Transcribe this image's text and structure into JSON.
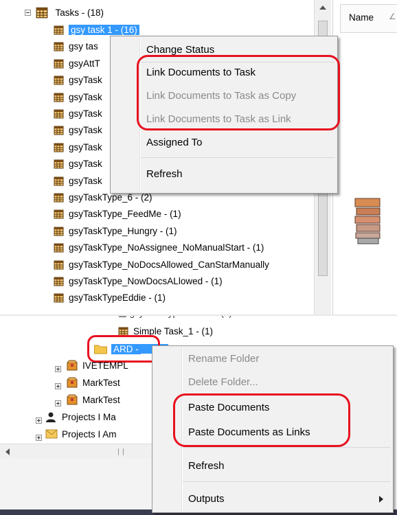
{
  "top_tree": {
    "root": {
      "label": "Tasks - (18)"
    },
    "items": [
      {
        "label": "gsy task 1 - (16)",
        "selected": true
      },
      {
        "label": "gsy tas"
      },
      {
        "label": "gsyAttT"
      },
      {
        "label": "gsyTask"
      },
      {
        "label": "gsyTask"
      },
      {
        "label": "gsyTask"
      },
      {
        "label": "gsyTask"
      },
      {
        "label": "gsyTask"
      },
      {
        "label": "gsyTask"
      },
      {
        "label": "gsyTask"
      },
      {
        "label": "gsyTaskType_6 - (2)"
      },
      {
        "label": "gsyTaskType_FeedMe - (1)"
      },
      {
        "label": "gsyTaskType_Hungry - (1)"
      },
      {
        "label": "gsyTaskType_NoAssignee_NoManualStart - (1)"
      },
      {
        "label": "gsyTaskType_NoDocsAllowed_CanStarManually"
      },
      {
        "label": "gsyTaskType_NowDocsALlowed - (1)"
      },
      {
        "label": "gsyTaskTypeEddie - (1)"
      }
    ]
  },
  "right_panel": {
    "column_header": "Name"
  },
  "top_menu": {
    "items": [
      {
        "label": "Change Status",
        "disabled": false
      },
      {
        "label": "Link Documents to Task",
        "disabled": false
      },
      {
        "label": "Link Documents to Task as Copy",
        "disabled": true
      },
      {
        "label": "Link Documents to Task as Link",
        "disabled": true
      },
      {
        "label": "Assigned To",
        "disabled": false
      },
      {
        "label": "Refresh",
        "disabled": false
      }
    ]
  },
  "bottom_tree": {
    "items": [
      {
        "label": "Simple Task_1 - (1)"
      },
      {
        "label": "ARD -",
        "selected": true
      },
      {
        "label": "IVETEMPL"
      },
      {
        "label": "MarkTest"
      },
      {
        "label": "MarkTest"
      },
      {
        "label": "Projects I Ma"
      },
      {
        "label": "Projects I Am"
      }
    ]
  },
  "bottom_menu": {
    "items": [
      {
        "label": "Rename Folder",
        "disabled": true
      },
      {
        "label": "Delete Folder...",
        "disabled": true
      },
      {
        "label": "Paste Documents",
        "disabled": false
      },
      {
        "label": "Paste Documents as Links",
        "disabled": false
      },
      {
        "label": "Refresh",
        "disabled": false
      },
      {
        "label": "Outputs",
        "disabled": false
      }
    ]
  },
  "colors": {
    "selection": "#3399ff",
    "annotation": "#e8101f",
    "menu_background": "#f1f1f1"
  }
}
